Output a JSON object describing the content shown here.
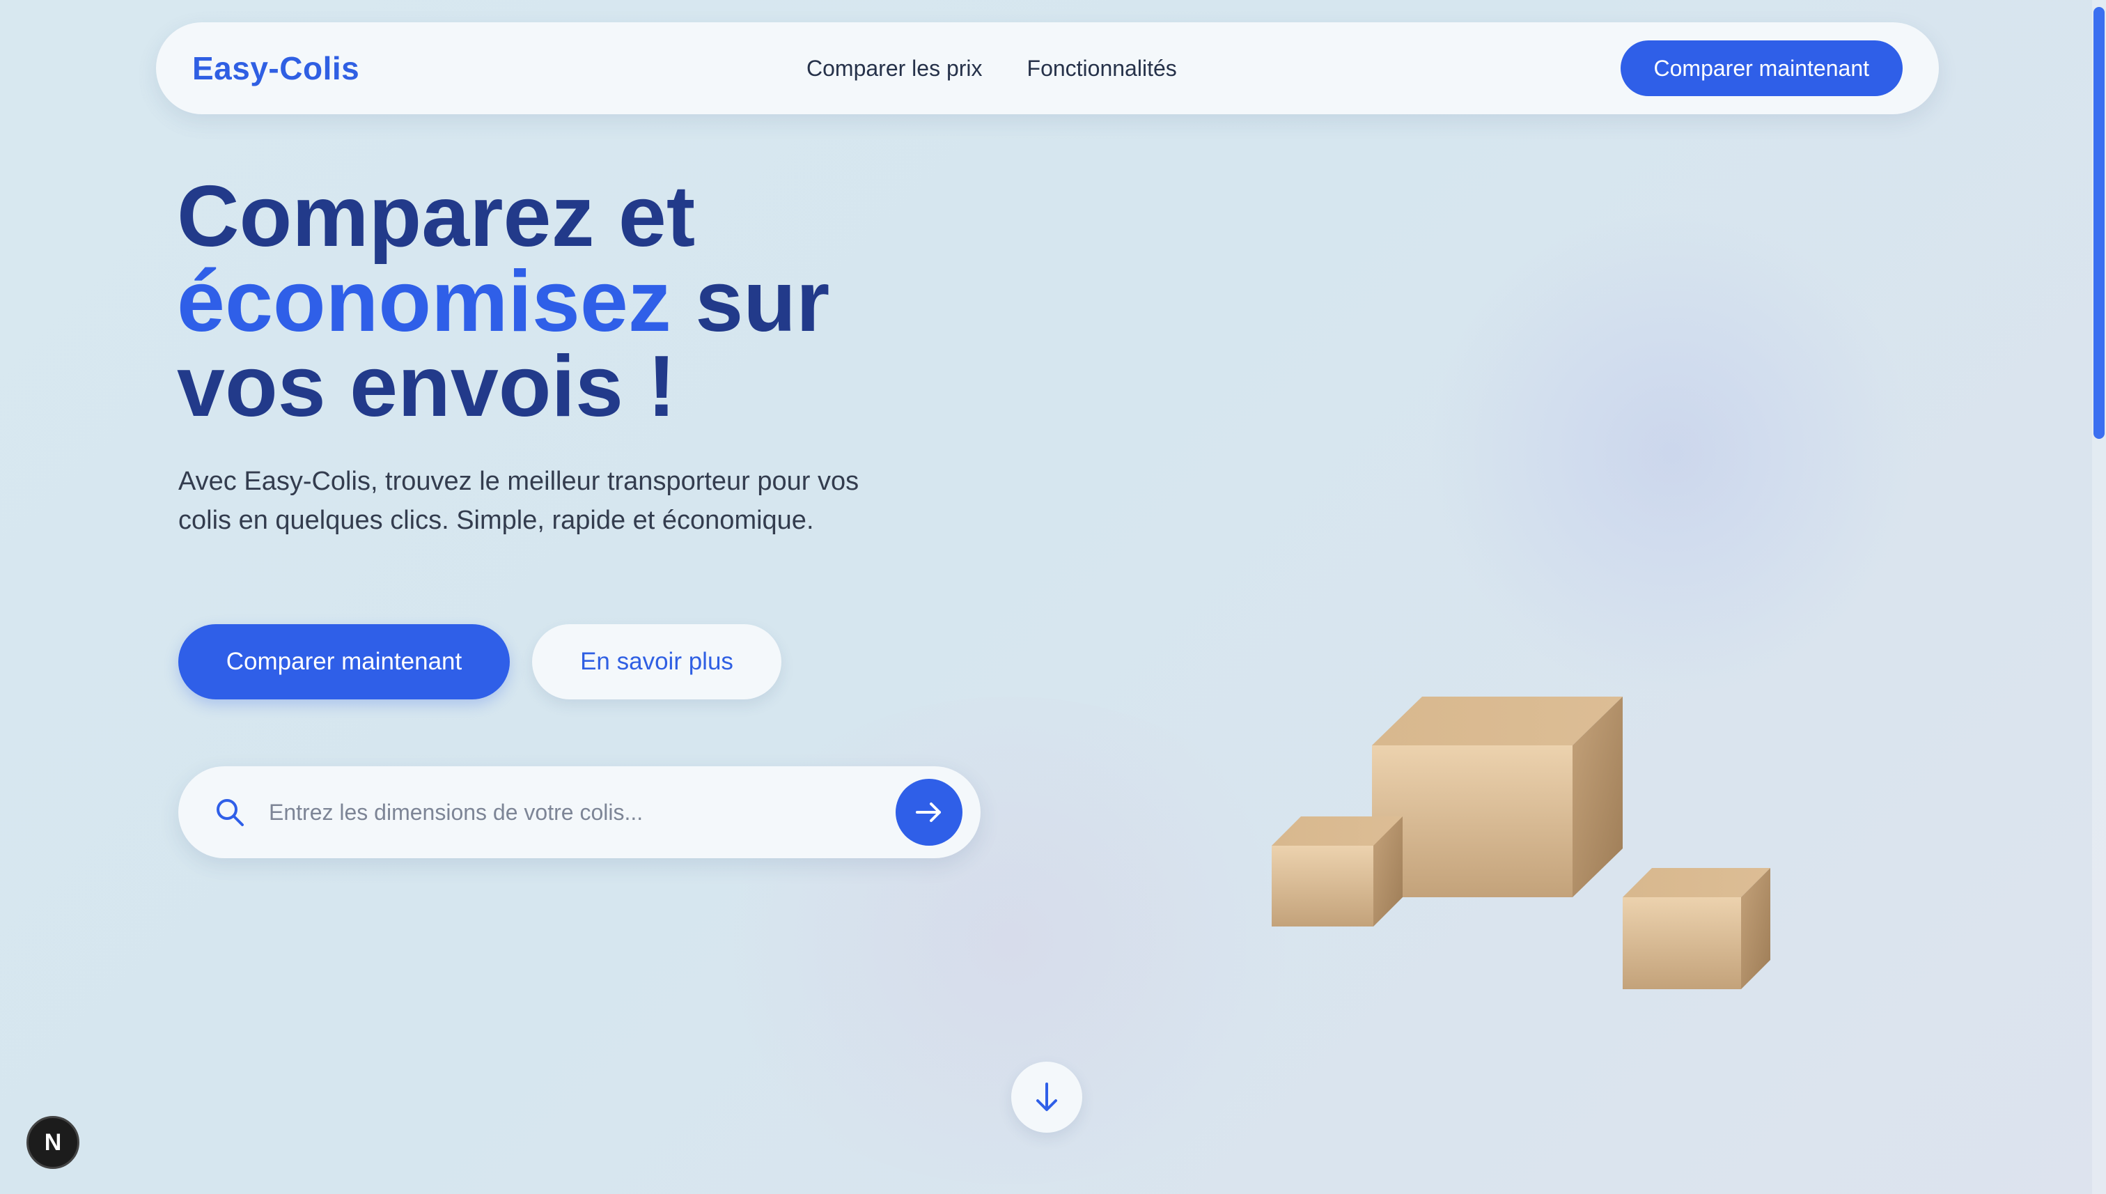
{
  "navbar": {
    "brand": "Easy-Colis",
    "links": [
      "Comparer les prix",
      "Fonctionnalités"
    ],
    "cta_label": "Comparer maintenant"
  },
  "hero": {
    "title_line1": "Comparez et",
    "title_accent": "économisez",
    "title_line2_rest": " sur",
    "title_line3": "vos envois !",
    "subtitle": "Avec Easy-Colis, trouvez le meilleur transporteur pour vos colis en quelques clics. Simple, rapide et économique.",
    "primary_button": "Comparer maintenant",
    "secondary_button": "En savoir plus"
  },
  "search": {
    "placeholder": "Entrez les dimensions de votre colis...",
    "value": "",
    "icon": "search-icon",
    "submit_icon": "arrow-right-icon"
  },
  "scroll_down": {
    "icon": "arrow-down-icon"
  },
  "badge": {
    "label": "N"
  },
  "colors": {
    "accent": "#2f5fe8",
    "title": "#223a8a",
    "box": "#d8b88e"
  }
}
